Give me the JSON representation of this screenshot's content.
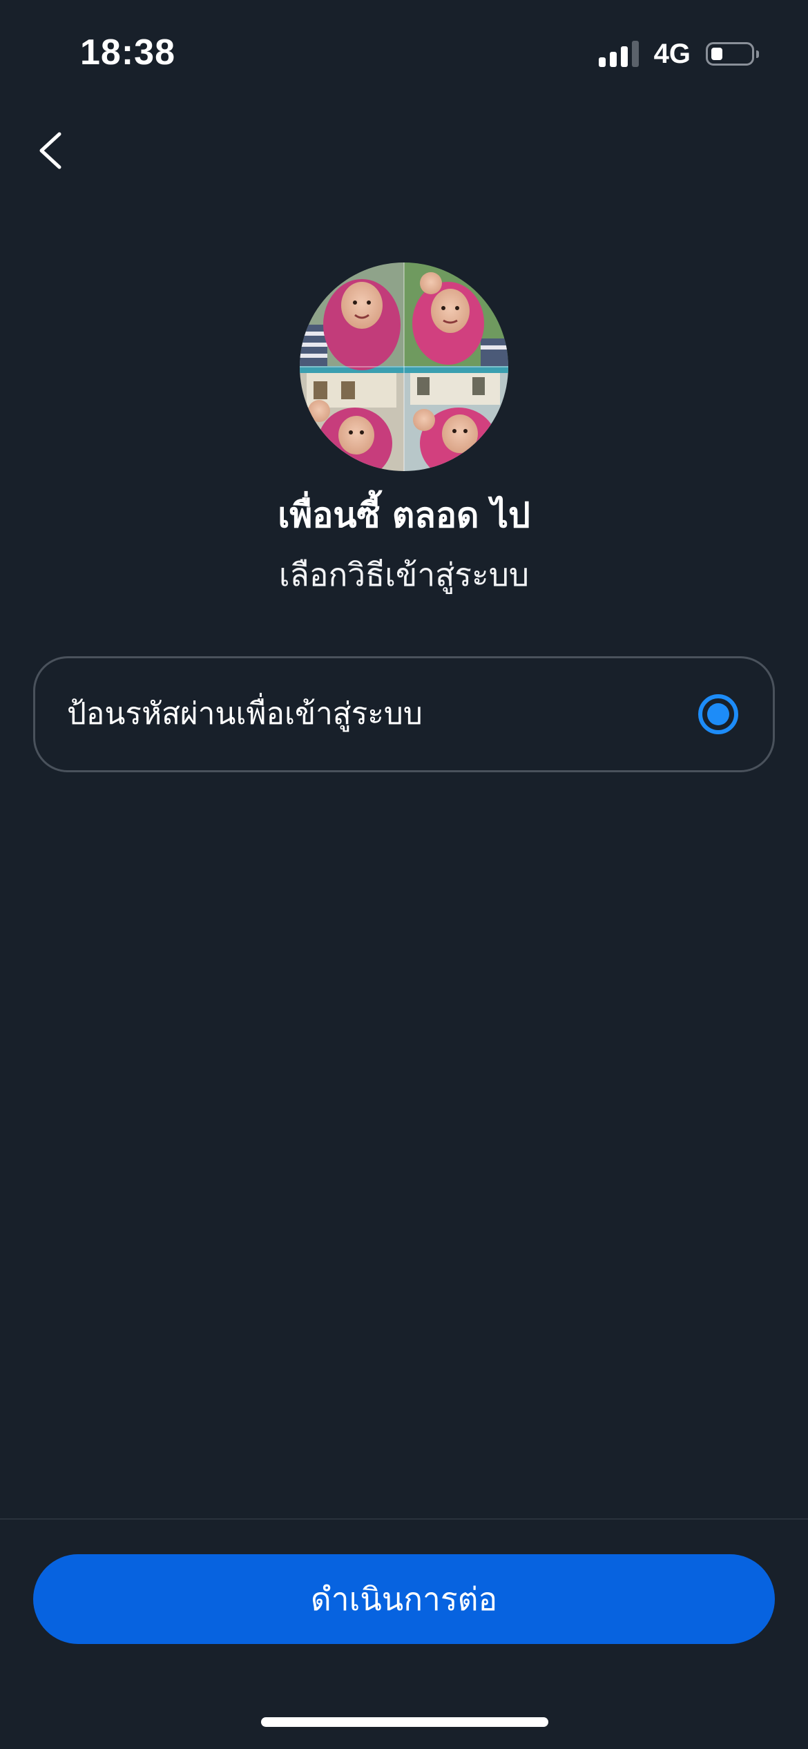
{
  "status_bar": {
    "time": "18:38",
    "network": "4G",
    "signal_icon": "cellular-signal-icon",
    "signal_bars_active": 3,
    "signal_bars_total": 4,
    "battery_icon": "battery-icon",
    "battery_level": 0.3
  },
  "nav": {
    "back_icon": "chevron-left-icon"
  },
  "profile": {
    "name": "เพื่อนซี้ ตลอด ไป",
    "subtitle": "เลือกวิธีเข้าสู่ระบบ"
  },
  "options": [
    {
      "label": "ป้อนรหัสผ่านเพื่อเข้าสู่ระบบ",
      "selected": true
    }
  ],
  "footer": {
    "continue_label": "ดำเนินการต่อ"
  },
  "colors": {
    "background": "#18202a",
    "accent": "#0763e0",
    "radio": "#1d8cf8",
    "card_border": "#4a525c"
  }
}
